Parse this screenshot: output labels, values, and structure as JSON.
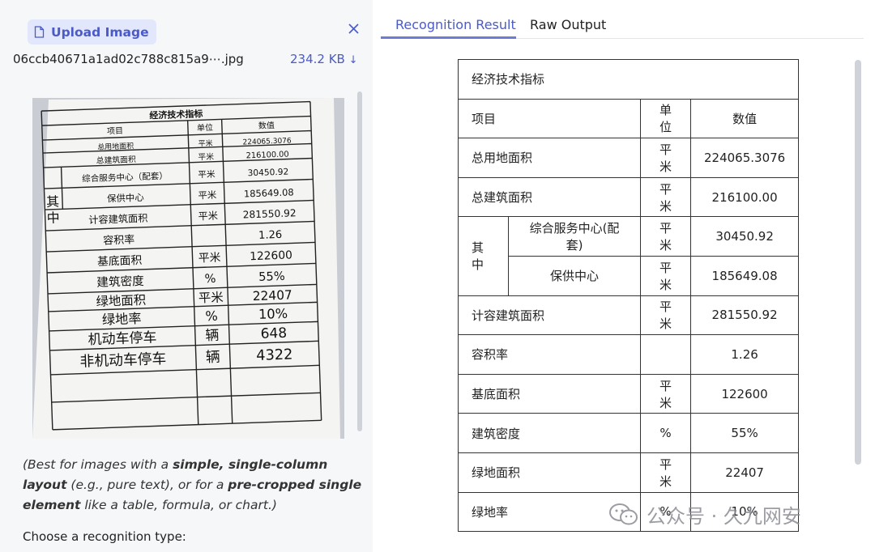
{
  "upload": {
    "button_label": "Upload Image",
    "file_name": "06ccb40671a1ad02c788c815a9⋯.jpg",
    "file_size": "234.2 KB"
  },
  "photo": {
    "title": "经济技术指标",
    "headers": [
      "项目",
      "单位",
      "数值"
    ],
    "rows": [
      [
        "总用地面积",
        "平米",
        "224065.3076"
      ],
      [
        "总建筑面积",
        "平米",
        "216100.00"
      ],
      [
        "综合服务中心（配套）",
        "平米",
        "30450.92"
      ],
      [
        "保供中心",
        "平米",
        "185649.08"
      ],
      [
        "计容建筑面积",
        "平米",
        "281550.92"
      ],
      [
        "容积率",
        "",
        "1.26"
      ],
      [
        "基底面积",
        "平米",
        "122600"
      ],
      [
        "建筑密度",
        "%",
        "55%"
      ],
      [
        "绿地面积",
        "平米",
        "22407"
      ],
      [
        "绿地率",
        "%",
        "10%"
      ],
      [
        "机动车停车",
        "辆",
        "648"
      ],
      [
        "非机动车停车",
        "辆",
        "4322"
      ]
    ],
    "group_label_top": "其",
    "group_label_bottom": "中"
  },
  "caption": {
    "p1": "(Best for images with a ",
    "b1": "simple, single-column layout",
    "p2": " (e.g., pure text), or for a ",
    "b2": "pre-cropped single element",
    "p3": " like a table, formula, or chart.)"
  },
  "choose_label": "Choose a recognition type:",
  "tabs": {
    "result": "Recognition Result",
    "raw": "Raw Output"
  },
  "table": {
    "title": "经济技术指标",
    "header": {
      "item": "项目",
      "unit": "单位",
      "value": "数值"
    },
    "rows": [
      {
        "item": "总用地面积",
        "unit": "平米",
        "value": "224065.3076"
      },
      {
        "item": "总建筑面积",
        "unit": "平米",
        "value": "216100.00"
      },
      {
        "group": "其中",
        "item": "综合服务中心(配套)",
        "unit": "平米",
        "value": "30450.92"
      },
      {
        "item": "保供中心",
        "unit": "平米",
        "value": "185649.08"
      },
      {
        "item": "计容建筑面积",
        "unit": "平米",
        "value": "281550.92"
      },
      {
        "item": "容积率",
        "unit": "",
        "value": "1.26"
      },
      {
        "item": "基底面积",
        "unit": "平米",
        "value": "122600"
      },
      {
        "item": "建筑密度",
        "unit": "%",
        "value": "55%"
      },
      {
        "item": "绿地面积",
        "unit": "平米",
        "value": "22407"
      },
      {
        "item": "绿地率",
        "unit": "%",
        "value": "10%"
      }
    ]
  },
  "watermark": "公众号 · 久九网安",
  "colors": {
    "accent": "#4a5bc9",
    "accent_bg": "#e3e7fb"
  }
}
